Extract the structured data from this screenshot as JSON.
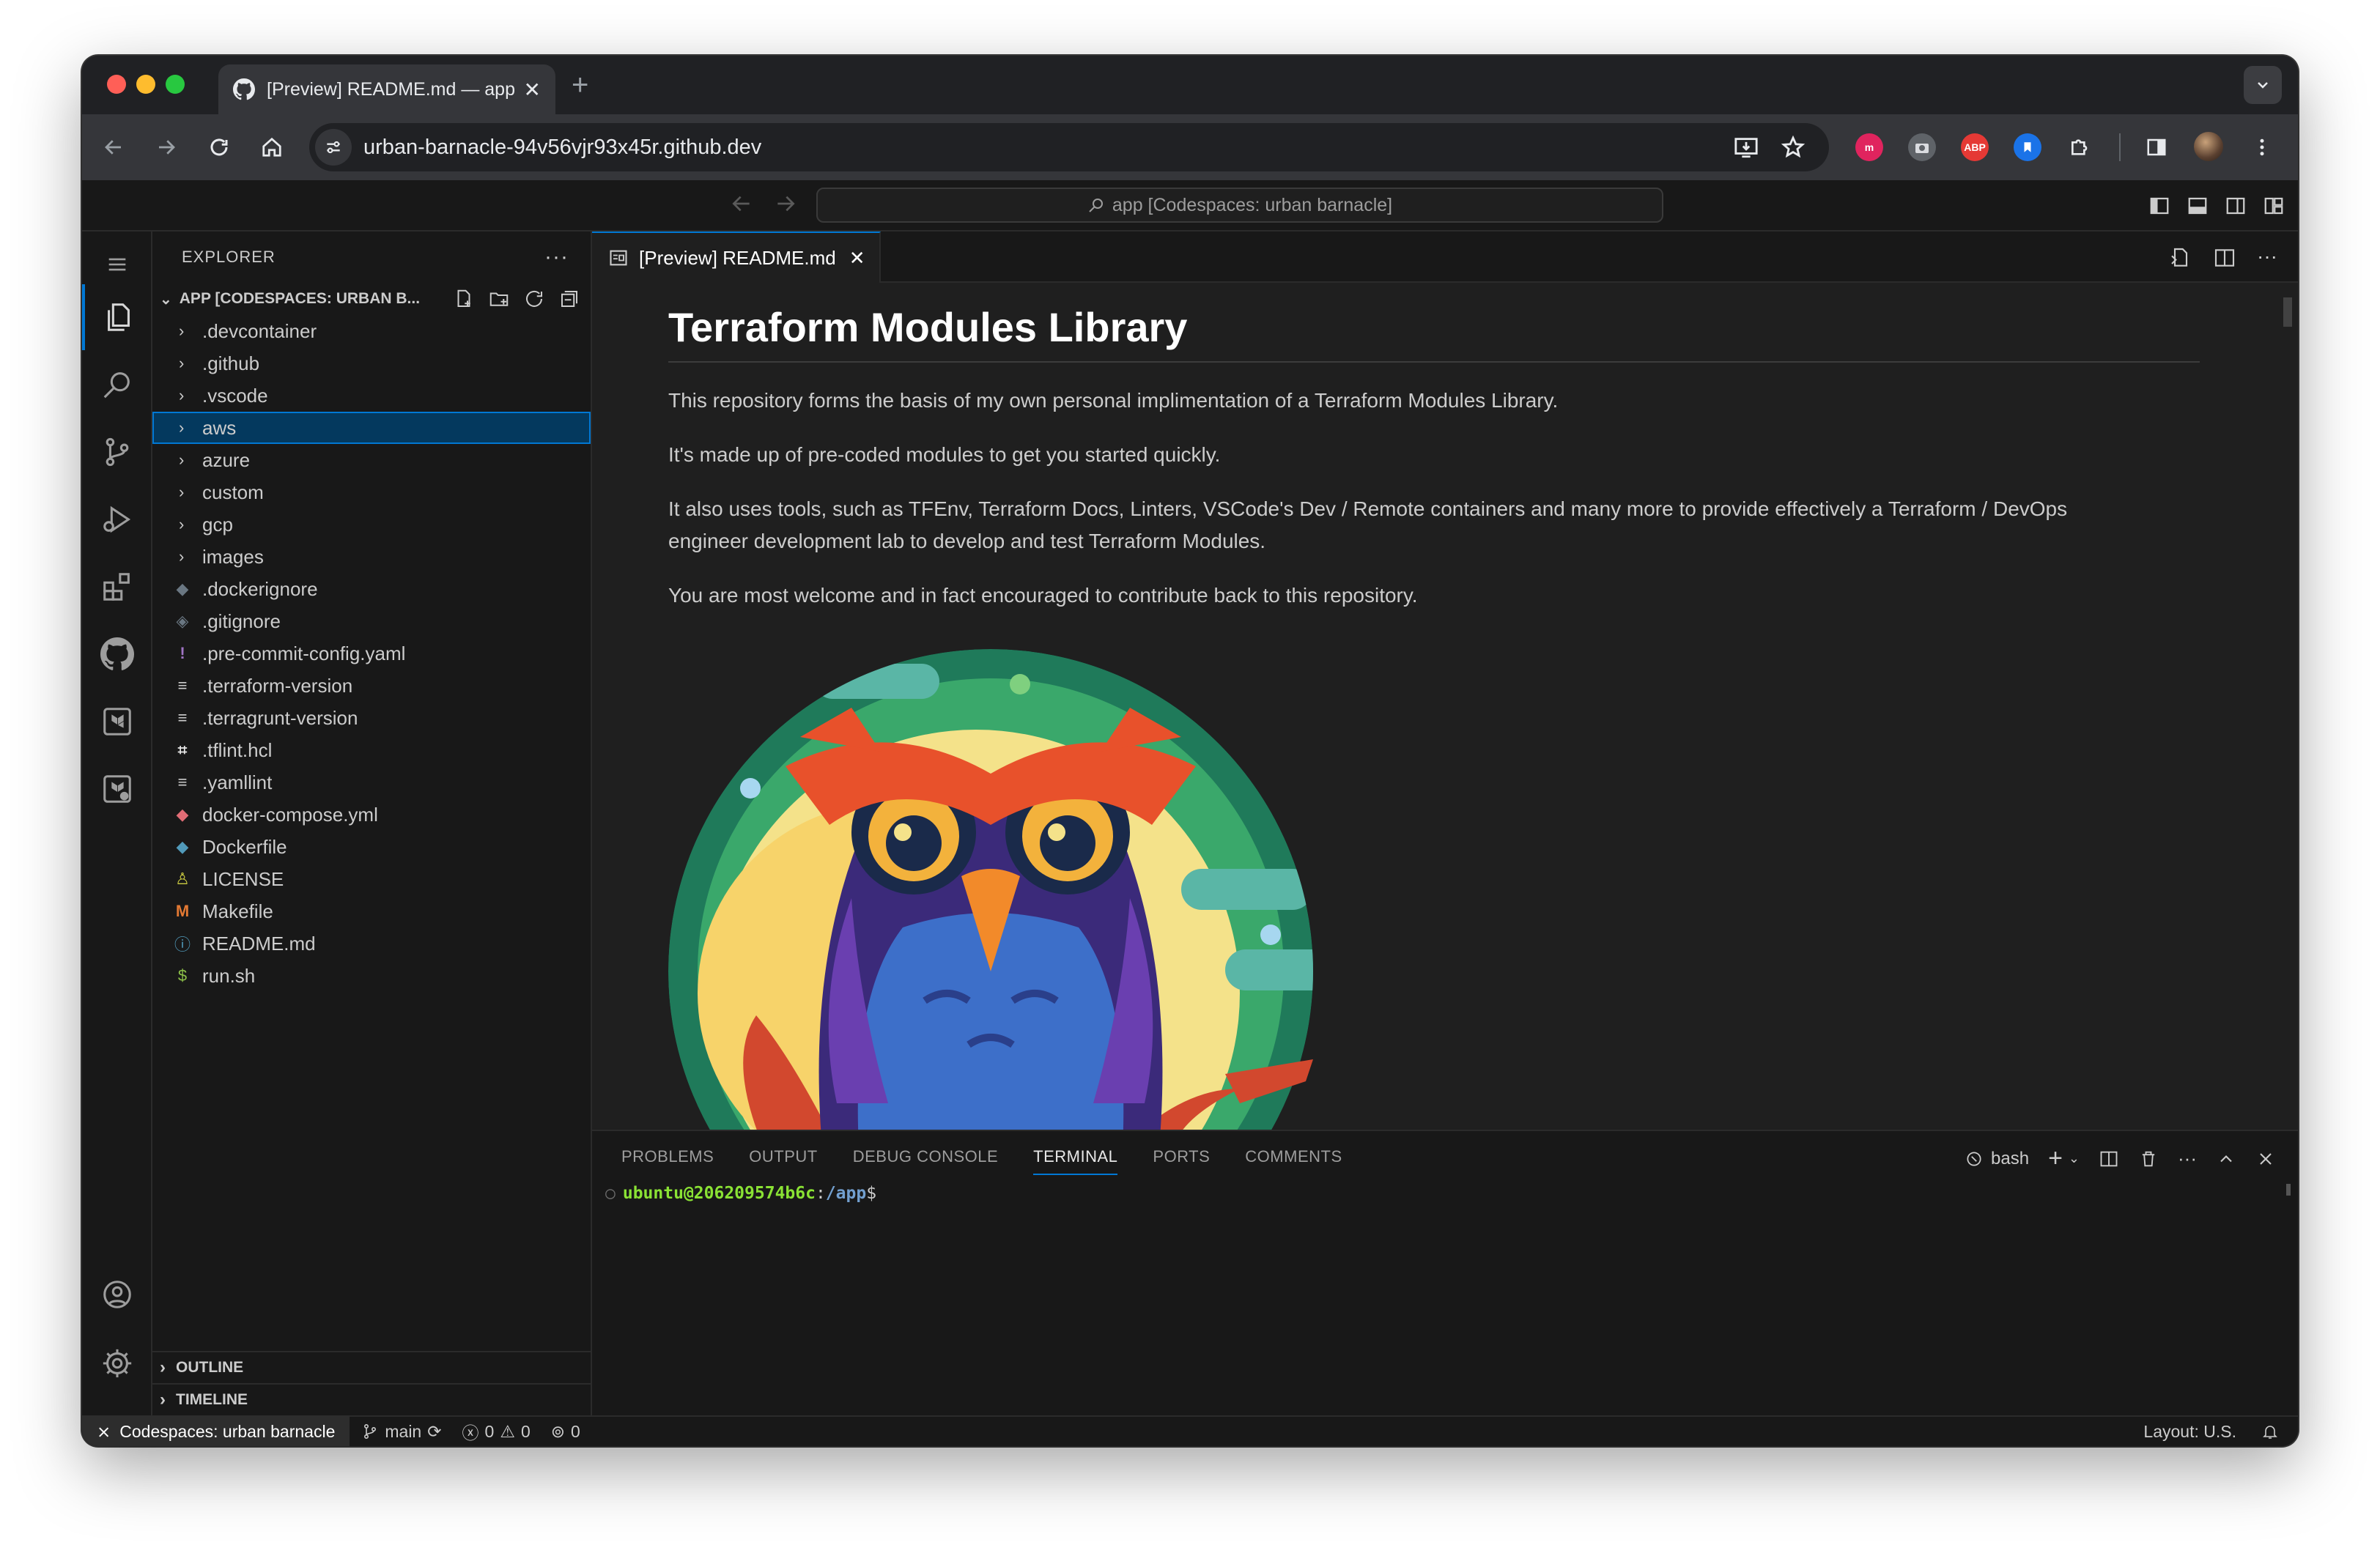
{
  "browser": {
    "tab_title": "[Preview] README.md — app",
    "new_tab": "+",
    "url": "urban-barnacle-94v56vjr93x45r.github.dev",
    "extensions": [
      "abp-icon",
      "bookmark-icon"
    ],
    "ext_abp_label": "ABP",
    "colors": {
      "close": "#ff5f57",
      "minimize": "#febc2e",
      "maximize": "#28c840"
    }
  },
  "vscode": {
    "command_center": "app [Codespaces: urban barnacle]",
    "explorer": {
      "title": "EXPLORER",
      "more": "···",
      "root": "APP [CODESPACES: URBAN B...",
      "items": [
        {
          "type": "folder",
          "label": ".devcontainer"
        },
        {
          "type": "folder",
          "label": ".github"
        },
        {
          "type": "folder",
          "label": ".vscode"
        },
        {
          "type": "folder",
          "label": "aws",
          "selected": true
        },
        {
          "type": "folder",
          "label": "azure"
        },
        {
          "type": "folder",
          "label": "custom"
        },
        {
          "type": "folder",
          "label": "gcp"
        },
        {
          "type": "folder",
          "label": "images"
        },
        {
          "type": "file",
          "label": ".dockerignore",
          "icon": "docker-icon"
        },
        {
          "type": "file",
          "label": ".gitignore",
          "icon": "git-icon"
        },
        {
          "type": "file",
          "label": ".pre-commit-config.yaml",
          "icon": "exclamation-icon"
        },
        {
          "type": "file",
          "label": ".terraform-version",
          "icon": "lines-icon"
        },
        {
          "type": "file",
          "label": ".terragrunt-version",
          "icon": "lines-icon"
        },
        {
          "type": "file",
          "label": ".tflint.hcl",
          "icon": "hcl-icon"
        },
        {
          "type": "file",
          "label": ".yamllint",
          "icon": "lines-icon"
        },
        {
          "type": "file",
          "label": "docker-compose.yml",
          "icon": "docker-compose-icon"
        },
        {
          "type": "file",
          "label": "Dockerfile",
          "icon": "docker-icon"
        },
        {
          "type": "file",
          "label": "LICENSE",
          "icon": "license-icon"
        },
        {
          "type": "file",
          "label": "Makefile",
          "icon": "makefile-icon"
        },
        {
          "type": "file",
          "label": "README.md",
          "icon": "info-icon"
        },
        {
          "type": "file",
          "label": "run.sh",
          "icon": "shell-icon"
        }
      ],
      "outline": "OUTLINE",
      "timeline": "TIMELINE"
    },
    "editor": {
      "tab_label": "[Preview] README.md",
      "heading": "Terraform Modules Library",
      "paragraphs": [
        "This repository forms the basis of my own personal implimentation of a Terraform Modules Library.",
        "It's made up of pre-coded modules to get you started quickly.",
        "It also uses tools, such as TFEnv, Terraform Docs, Linters, VSCode's Dev / Remote containers and many more to provide effectively a Terraform / DevOps engineer development lab to develop and test Terraform Modules.",
        "You are most welcome and in fact encouraged to contribute back to this repository."
      ]
    },
    "panel": {
      "tabs": [
        "PROBLEMS",
        "OUTPUT",
        "DEBUG CONSOLE",
        "TERMINAL",
        "PORTS",
        "COMMENTS"
      ],
      "active_tab": "TERMINAL",
      "shell": "bash",
      "more": "···",
      "prompt_user": "ubuntu@206209574b6c",
      "prompt_sep": ":",
      "prompt_path": "/app",
      "prompt_end": "$"
    },
    "statusbar": {
      "remote": "Codespaces: urban barnacle",
      "branch": "main",
      "errors": "0",
      "warnings": "0",
      "ports": "0",
      "layout": "Layout: U.S."
    }
  }
}
